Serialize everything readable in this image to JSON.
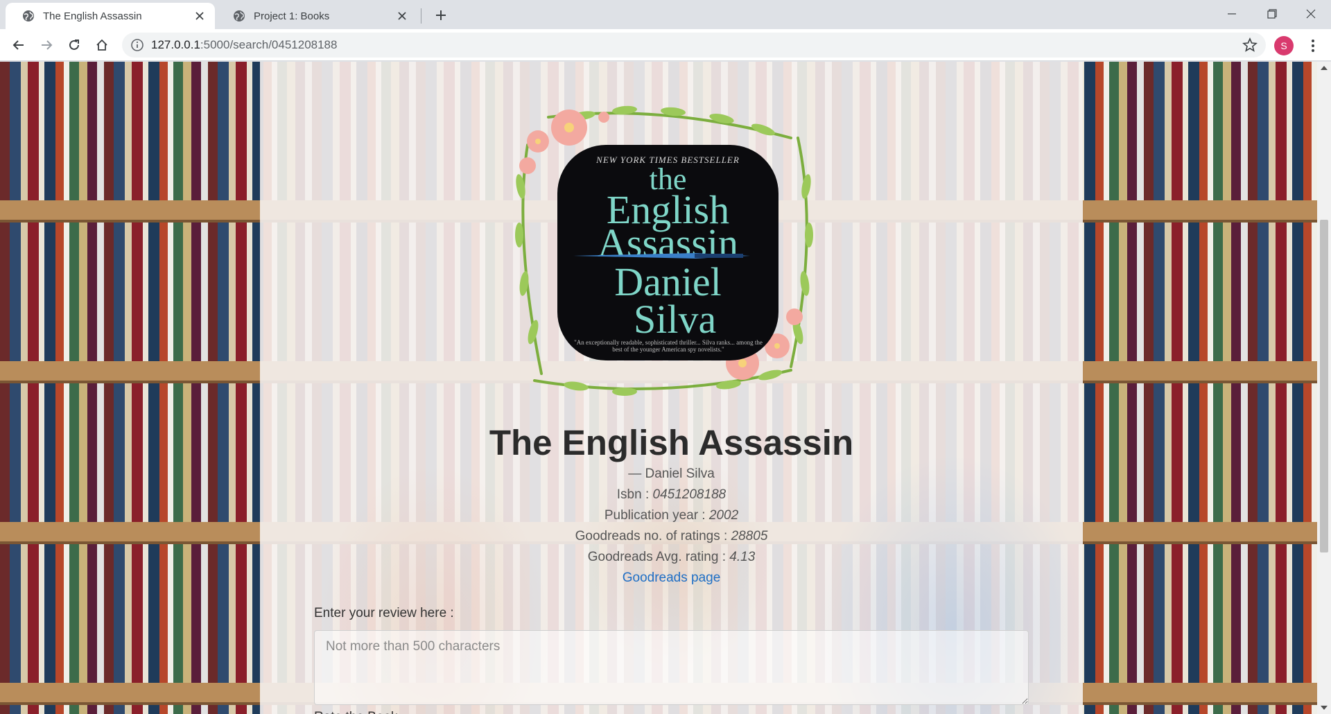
{
  "browser": {
    "tabs": [
      {
        "title": "The English Assassin",
        "active": true
      },
      {
        "title": "Project 1: Books",
        "active": false
      }
    ],
    "url": {
      "host": "127.0.0.1",
      "path": ":5000/search/0451208188"
    },
    "profile_initial": "S"
  },
  "book": {
    "cover": {
      "top_banner": "NEW YORK TIMES BESTSELLER",
      "line1": "the",
      "line2": "English",
      "line3": "Assassin",
      "line4": "Daniel",
      "line5": "Silva",
      "quote": "\"An exceptionally readable, sophisticated thriller... Silva ranks... among the best of the younger American spy novelists.\""
    },
    "title": "The English Assassin",
    "author": "— Daniel Silva",
    "isbn_label": "Isbn : ",
    "isbn": "0451208188",
    "year_label": "Publication year : ",
    "year": "2002",
    "ratings_count_label": "Goodreads no. of ratings : ",
    "ratings_count": "28805",
    "avg_rating_label": "Goodreads Avg. rating : ",
    "avg_rating": "4.13",
    "goodreads_link": "Goodreads page"
  },
  "review": {
    "label": "Enter your review here :",
    "placeholder": "Not more than 500 characters",
    "rate_label": "Rate the Book"
  },
  "colors": {
    "link": "#1f6fc5",
    "avatar": "#d93a6e",
    "panel": "#f5f1ee"
  }
}
